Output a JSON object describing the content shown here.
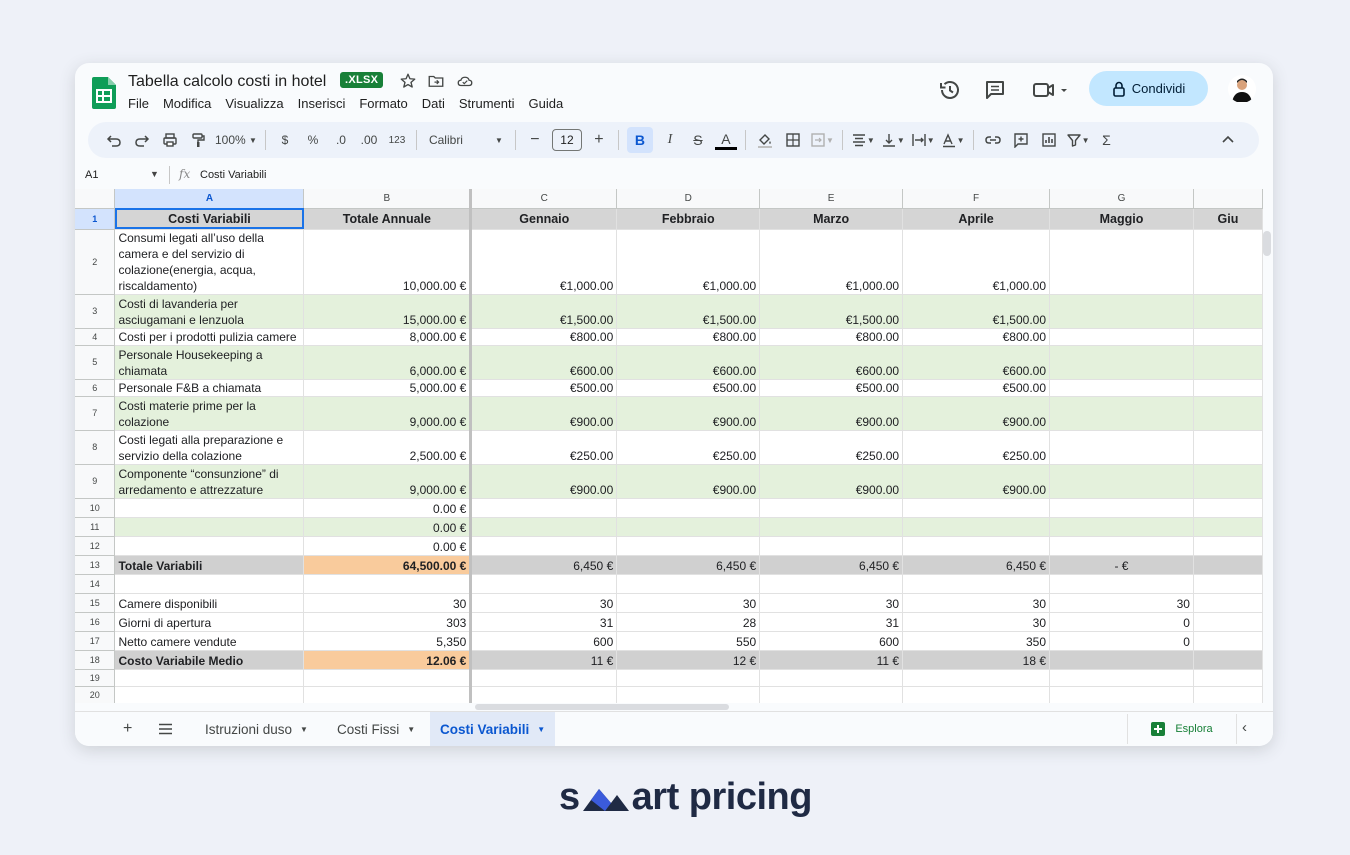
{
  "doc": {
    "title": "Tabella calcolo costi in hotel",
    "badge": ".XLSX"
  },
  "menu": [
    "File",
    "Modifica",
    "Visualizza",
    "Inserisci",
    "Formato",
    "Dati",
    "Strumenti",
    "Guida"
  ],
  "share_label": "Condividi",
  "toolbar": {
    "zoom": "100%",
    "currency": "$",
    "percent": "%",
    "dec_less": ".0",
    "dec_more": ".00",
    "format_123": "123",
    "font": "Calibri",
    "font_size": "12",
    "bold": "B",
    "italic": "I",
    "strike": "S",
    "text_color": "A",
    "sum": "Σ"
  },
  "formula_bar": {
    "cell_ref": "A1",
    "content": "Costi Variabili"
  },
  "columns": [
    "A",
    "B",
    "C",
    "D",
    "E",
    "F",
    "G",
    ""
  ],
  "rows": [
    {
      "n": "1",
      "cells": [
        "Costi Variabili",
        "Totale Annuale",
        "Gennaio",
        "Febbraio",
        "Marzo",
        "Aprile",
        "Maggio",
        "Giu"
      ]
    },
    {
      "n": "2",
      "cells": [
        "Consumi legati all’uso della camera e del servizio di colazione(energia, acqua, riscaldamento)",
        "10,000.00 €",
        "€1,000.00",
        "€1,000.00",
        "€1,000.00",
        "€1,000.00",
        "",
        ""
      ]
    },
    {
      "n": "3",
      "cells": [
        "Costi di lavanderia per asciugamani e lenzuola",
        "15,000.00 €",
        "€1,500.00",
        "€1,500.00",
        "€1,500.00",
        "€1,500.00",
        "",
        ""
      ]
    },
    {
      "n": "4",
      "cells": [
        "Costi per i prodotti pulizia camere",
        "8,000.00 €",
        "€800.00",
        "€800.00",
        "€800.00",
        "€800.00",
        "",
        ""
      ]
    },
    {
      "n": "5",
      "cells": [
        "Personale Housekeeping a chiamata",
        "6,000.00 €",
        "€600.00",
        "€600.00",
        "€600.00",
        "€600.00",
        "",
        ""
      ]
    },
    {
      "n": "6",
      "cells": [
        "Personale F&B a chiamata",
        "5,000.00 €",
        "€500.00",
        "€500.00",
        "€500.00",
        "€500.00",
        "",
        ""
      ]
    },
    {
      "n": "7",
      "cells": [
        "Costi materie prime per la colazione",
        "9,000.00 €",
        "€900.00",
        "€900.00",
        "€900.00",
        "€900.00",
        "",
        ""
      ]
    },
    {
      "n": "8",
      "cells": [
        "Costi legati alla preparazione e servizio della colazione",
        "2,500.00 €",
        "€250.00",
        "€250.00",
        "€250.00",
        "€250.00",
        "",
        ""
      ]
    },
    {
      "n": "9",
      "cells": [
        "Componente “consunzione” di arredamento e attrezzature",
        "9,000.00 €",
        "€900.00",
        "€900.00",
        "€900.00",
        "€900.00",
        "",
        ""
      ]
    },
    {
      "n": "10",
      "cells": [
        "",
        "0.00 €",
        "",
        "",
        "",
        "",
        "",
        ""
      ]
    },
    {
      "n": "11",
      "cells": [
        "",
        "0.00 €",
        "",
        "",
        "",
        "",
        "",
        ""
      ]
    },
    {
      "n": "12",
      "cells": [
        "",
        "0.00 €",
        "",
        "",
        "",
        "",
        "",
        ""
      ]
    },
    {
      "n": "13",
      "cells": [
        "Totale Variabili",
        "64,500.00 €",
        "6,450 €",
        "6,450 €",
        "6,450 €",
        "6,450 €",
        "-    €",
        ""
      ]
    },
    {
      "n": "14",
      "cells": [
        "",
        "",
        "",
        "",
        "",
        "",
        "",
        ""
      ]
    },
    {
      "n": "15",
      "cells": [
        "Camere disponibili",
        "30",
        "30",
        "30",
        "30",
        "30",
        "30",
        ""
      ]
    },
    {
      "n": "16",
      "cells": [
        "Giorni di apertura",
        "303",
        "31",
        "28",
        "31",
        "30",
        "0",
        ""
      ]
    },
    {
      "n": "17",
      "cells": [
        "Netto camere vendute",
        "5,350",
        "600",
        "550",
        "600",
        "350",
        "0",
        ""
      ]
    },
    {
      "n": "18",
      "cells": [
        "Costo Variabile Medio",
        "12.06 €",
        "11 €",
        "12 €",
        "11 €",
        "18 €",
        "",
        ""
      ]
    },
    {
      "n": "19",
      "cells": [
        "",
        "",
        "",
        "",
        "",
        "",
        "",
        ""
      ]
    },
    {
      "n": "20",
      "cells": [
        "",
        "",
        "",
        "",
        "",
        "",
        "",
        ""
      ]
    }
  ],
  "sheets": [
    {
      "label": "Istruzioni duso",
      "active": false
    },
    {
      "label": "Costi Fissi",
      "active": false
    },
    {
      "label": "Costi Variabili",
      "active": true
    }
  ],
  "explore_label": "Esplora",
  "brand": {
    "pre": "s",
    "post": "art pricing"
  }
}
